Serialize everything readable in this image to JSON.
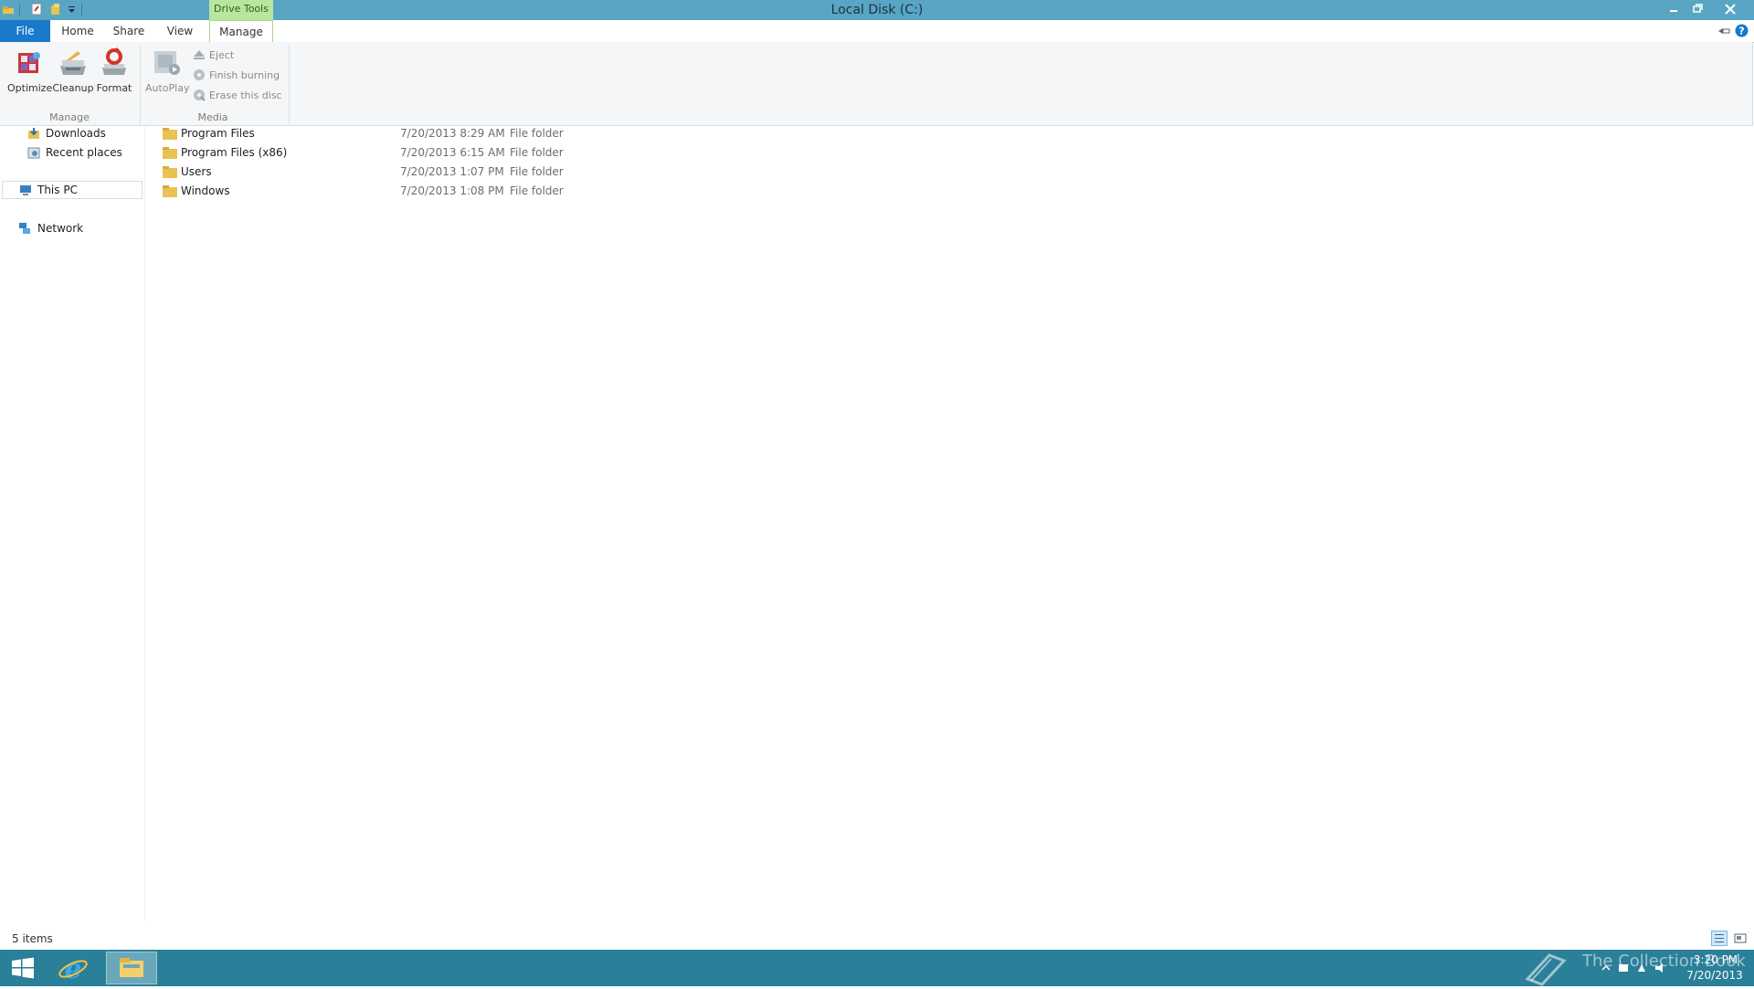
{
  "window": {
    "title": "Local Disk (C:)",
    "context_tab": "Drive Tools"
  },
  "tabs": [
    {
      "label": "File"
    },
    {
      "label": "Home"
    },
    {
      "label": "Share"
    },
    {
      "label": "View"
    },
    {
      "label": "Manage"
    }
  ],
  "ribbon": {
    "manage_group": {
      "label": "Manage",
      "optimize": "Optimize",
      "cleanup": "Cleanup",
      "format": "Format"
    },
    "media_group": {
      "label": "Media",
      "autoplay": "AutoPlay",
      "eject": "Eject",
      "finish_burning": "Finish burning",
      "erase_disc": "Erase this disc"
    }
  },
  "nav": {
    "downloads": "Downloads",
    "recent_places": "Recent places",
    "this_pc": "This PC",
    "network": "Network"
  },
  "files": [
    {
      "name": "Program Files",
      "date": "7/20/2013 8:29 AM",
      "type": "File folder"
    },
    {
      "name": "Program Files (x86)",
      "date": "7/20/2013 6:15 AM",
      "type": "File folder"
    },
    {
      "name": "Users",
      "date": "7/20/2013 1:07 PM",
      "type": "File folder"
    },
    {
      "name": "Windows",
      "date": "7/20/2013 1:08 PM",
      "type": "File folder"
    }
  ],
  "status": {
    "item_count": "5 items"
  },
  "taskbar": {
    "watermark": "The Collection Book",
    "time": "3:20 PM",
    "date": "7/20/2013"
  },
  "colors": {
    "titlebar": "#58a6c4",
    "context_tab": "#b9e59e",
    "file_tab": "#1979ca",
    "taskbar": "#2a7f99",
    "close_button": "#c7403a"
  },
  "icons": [
    "explorer-icon",
    "new-folder-icon",
    "properties-icon",
    "dropdown-icon",
    "minimize-icon",
    "restore-icon",
    "close-icon",
    "pin-ribbon-icon",
    "help-icon",
    "optimize-icon",
    "cleanup-icon",
    "format-icon",
    "autoplay-icon",
    "eject-icon",
    "finish-burning-icon",
    "erase-disc-icon",
    "downloads-icon",
    "recent-places-icon",
    "this-pc-icon",
    "network-icon",
    "folder-icon",
    "details-view-icon",
    "large-icons-view-icon",
    "windows-start-icon",
    "internet-explorer-icon",
    "file-explorer-icon",
    "notification-icons"
  ]
}
